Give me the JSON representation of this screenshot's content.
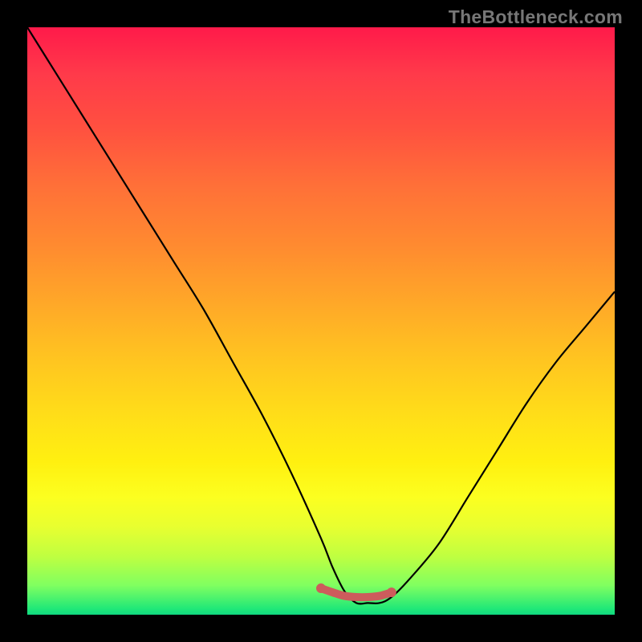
{
  "watermark": "TheBottleneck.com",
  "chart_data": {
    "type": "line",
    "title": "",
    "xlabel": "",
    "ylabel": "",
    "xlim": [
      0,
      100
    ],
    "ylim": [
      0,
      100
    ],
    "series": [
      {
        "name": "curve",
        "x": [
          0,
          5,
          10,
          15,
          20,
          25,
          30,
          35,
          40,
          45,
          50,
          52,
          54,
          56,
          58,
          60,
          62,
          65,
          70,
          75,
          80,
          85,
          90,
          95,
          100
        ],
        "values": [
          100,
          92,
          84,
          76,
          68,
          60,
          52,
          43,
          34,
          24,
          13,
          8,
          4,
          2,
          2,
          2,
          3,
          6,
          12,
          20,
          28,
          36,
          43,
          49,
          55
        ]
      },
      {
        "name": "highlight",
        "x": [
          50,
          52,
          54,
          56,
          58,
          60,
          62
        ],
        "values": [
          4.5,
          3.8,
          3.2,
          3.0,
          3.0,
          3.2,
          3.8
        ]
      }
    ],
    "colors": {
      "curve": "#000000",
      "highlight": "#cd5c5c"
    }
  }
}
